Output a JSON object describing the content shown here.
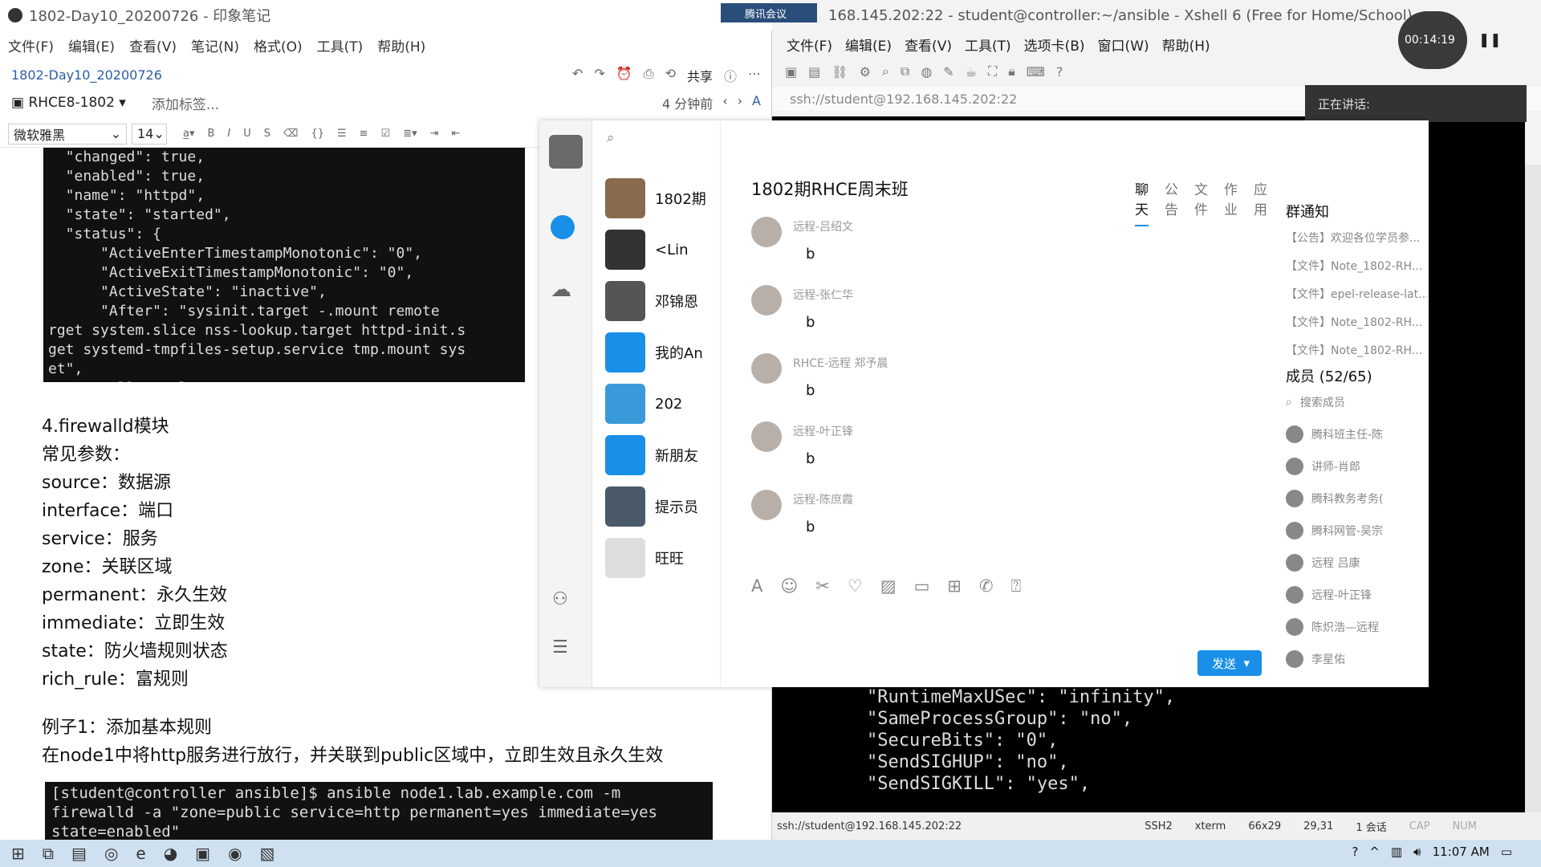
{
  "evernote": {
    "title": "1802-Day10_20200726 - 印象笔记",
    "menu": [
      "文件(F)",
      "编辑(E)",
      "查看(V)",
      "笔记(N)",
      "格式(O)",
      "工具(T)",
      "帮助(H)"
    ],
    "note_title": "1802-Day10_20200726",
    "share_label": "共享",
    "notebook": "RHCE8-1802",
    "add_tag": "添加标签...",
    "modified": "4 分钟前",
    "font_name": "微软雅黑",
    "font_size": "14",
    "code1": "  \"changed\": true,\n  \"enabled\": true,\n  \"name\": \"httpd\",\n  \"state\": \"started\",\n  \"status\": {\n      \"ActiveEnterTimestampMonotonic\": \"0\",\n      \"ActiveExitTimestampMonotonic\": \"0\",\n      \"ActiveState\": \"inactive\",\n      \"After\": \"sysinit.target -.mount remote\nrget system.slice nss-lookup.target httpd-init.s\nget systemd-tmpfiles-setup.service tmp.mount sys\net\",\n      \"AllowIsolate\": \"no\",",
    "section_title": "4.firewalld模块",
    "params_title": "常见参数：",
    "params": [
      "source：数据源",
      "interface：端口",
      "service：服务",
      "zone：关联区域",
      "permanent：永久生效",
      "immediate：立即生效",
      "state：防火墙规则状态",
      "rich_rule：富规则"
    ],
    "example_title": "例子1：添加基本规则",
    "example_desc": "在node1中将http服务进行放行，并关联到public区域中，立即生效且永久生效",
    "code2": "[student@controller ansible]$ ansible node1.lab.example.com -m firewalld -a \"zone=public service=http permanent=yes immediate=yes state=enabled\""
  },
  "xshell": {
    "title": "168.145.202:22 - student@controller:~/ansible - Xshell 6 (Free for Home/School)",
    "meeting_tag": "腾讯会议",
    "timer": "00:14:19",
    "menu": [
      "文件(F)",
      "编辑(E)",
      "查看(V)",
      "工具(T)",
      "选项卡(B)",
      "窗口(W)",
      "帮助(H)"
    ],
    "address": "ssh://student@192.168.145.202:22",
    "speaking": "正在讲话:",
    "terminal_text": "\"RuntimeMaxUSec\": \"infinity\",\n\"SameProcessGroup\": \"no\",\n\"SecureBits\": \"0\",\n\"SendSIGHUP\": \"no\",\n\"SendSIGKILL\": \"yes\",",
    "status": {
      "conn": "ssh://student@192.168.145.202:22",
      "proto": "SSH2",
      "term": "xterm",
      "size": "66x29",
      "pos": "29,31",
      "sessions": "1 会话",
      "cap": "CAP",
      "num": "NUM"
    }
  },
  "qq": {
    "group_name": "1802期RHCE周末班",
    "tabs": [
      "聊天",
      "公告",
      "文件",
      "作业",
      "应用"
    ],
    "conversations": [
      {
        "name": "1802期",
        "color": "#8a6a4e"
      },
      {
        "name": "<Lin",
        "color": "#333333"
      },
      {
        "name": "邓锦恩",
        "color": "#555555"
      },
      {
        "name": "我的An",
        "color": "#1a8fe8"
      },
      {
        "name": "202",
        "color": "#3a9ad9"
      },
      {
        "name": "新朋友",
        "color": "#1a8fe8"
      },
      {
        "name": "提示员",
        "color": "#4a5a6a"
      },
      {
        "name": "旺旺",
        "color": "#dddddd"
      }
    ],
    "messages": [
      {
        "sender": "远程-吕绍文",
        "text": "b"
      },
      {
        "sender": "远程-张仁华",
        "text": "b"
      },
      {
        "sender": "RHCE-远程 郑予晨",
        "text": "b"
      },
      {
        "sender": "远程-叶正锋",
        "text": "b"
      },
      {
        "sender": "远程-陈庶霞",
        "text": "b"
      }
    ],
    "send_label": "发送",
    "side": {
      "notice_title": "群通知",
      "notices": [
        "【公告】欢迎各位学员参...",
        "【文件】Note_1802-RH...",
        "【文件】epel-release-lat...",
        "【文件】Note_1802-RH...",
        "【文件】Note_1802-RH..."
      ],
      "members_title": "成员 (52/65)",
      "search_members": "搜索成员",
      "members": [
        "腾科班主任-陈",
        "讲师-肖郎",
        "腾科教务考务(",
        "腾科网管-吴宗",
        "远程 吕康",
        "远程-叶正锋",
        "陈炽浩—远程",
        "李星佑"
      ]
    }
  },
  "taskbar": {
    "time": "11:07 AM"
  }
}
